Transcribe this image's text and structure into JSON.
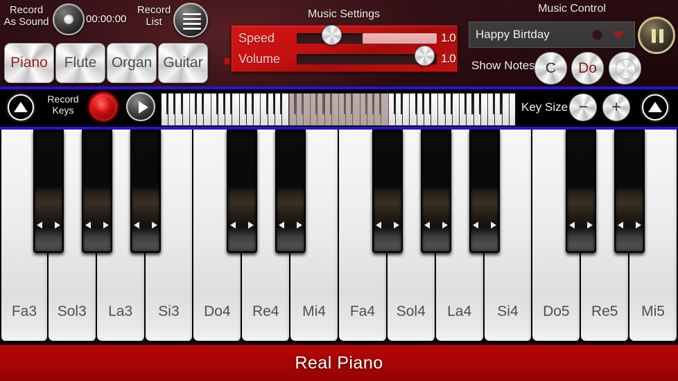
{
  "app": {
    "title": "Real Piano"
  },
  "record_as_sound": {
    "label": "Record\nAs Sound",
    "label_line1": "Record",
    "label_line2": "As Sound",
    "button_icon": "record-dot-icon",
    "timer": "00:00:00"
  },
  "record_list": {
    "label_line1": "Record",
    "label_line2": "List",
    "button_icon": "list-lines-icon"
  },
  "instruments": {
    "selected": "Piano",
    "items": [
      {
        "label": "Piano",
        "selected": true
      },
      {
        "label": "Flute",
        "selected": false
      },
      {
        "label": "Organ",
        "selected": false
      },
      {
        "label": "Guitar",
        "selected": false
      }
    ]
  },
  "music_settings": {
    "title": "Music Settings",
    "sliders": [
      {
        "name": "Speed",
        "value": "1.0",
        "position_pct": 26,
        "fill_pct": 100
      },
      {
        "name": "Volume",
        "value": "1.0",
        "position_pct": 93,
        "fill_pct": 0
      }
    ]
  },
  "music_control": {
    "title": "Music Control",
    "selected_song": "Happy Birtday",
    "dropdown_icon": "chevron-down-icon",
    "record_indicator_icon": "circle-icon",
    "pause_button_icon": "pause-icon",
    "show_notes_label": "Show Notes",
    "note_modes": [
      {
        "label": "C",
        "selected": false
      },
      {
        "label": "Do",
        "selected": true
      },
      {
        "label": "",
        "selected": false
      }
    ]
  },
  "toolbar": {
    "scroll_left_icon": "triangle-up-icon",
    "scroll_right_icon": "triangle-up-icon",
    "record_keys_label_line1": "Record",
    "record_keys_label_line2": "Keys",
    "record_button_icon": "record-circle-icon",
    "play_button_icon": "play-triangle-icon",
    "key_size_label": "Key Size",
    "key_size_minus": "−",
    "key_size_plus": "+",
    "overview": {
      "total_white_keys": 50,
      "highlight_start_key": 18,
      "highlight_key_count": 14
    }
  },
  "piano": {
    "white_keys": [
      "Fa3",
      "Sol3",
      "La3",
      "Si3",
      "Do4",
      "Re4",
      "Mi4",
      "Fa4",
      "Sol4",
      "La4",
      "Si4",
      "Do5",
      "Re5",
      "Mi5"
    ],
    "black_key_after_index": [
      0,
      1,
      2,
      4,
      5,
      7,
      8,
      9,
      11,
      12
    ]
  },
  "footer": {
    "title": "Real Piano"
  },
  "colors": {
    "background": "#200a0d",
    "panel_red": "#c21010",
    "accent_blue": "#2a12d8",
    "footer_red": "#a80505",
    "selected_text": "#8f1c1c",
    "gold": "#cfc183"
  }
}
